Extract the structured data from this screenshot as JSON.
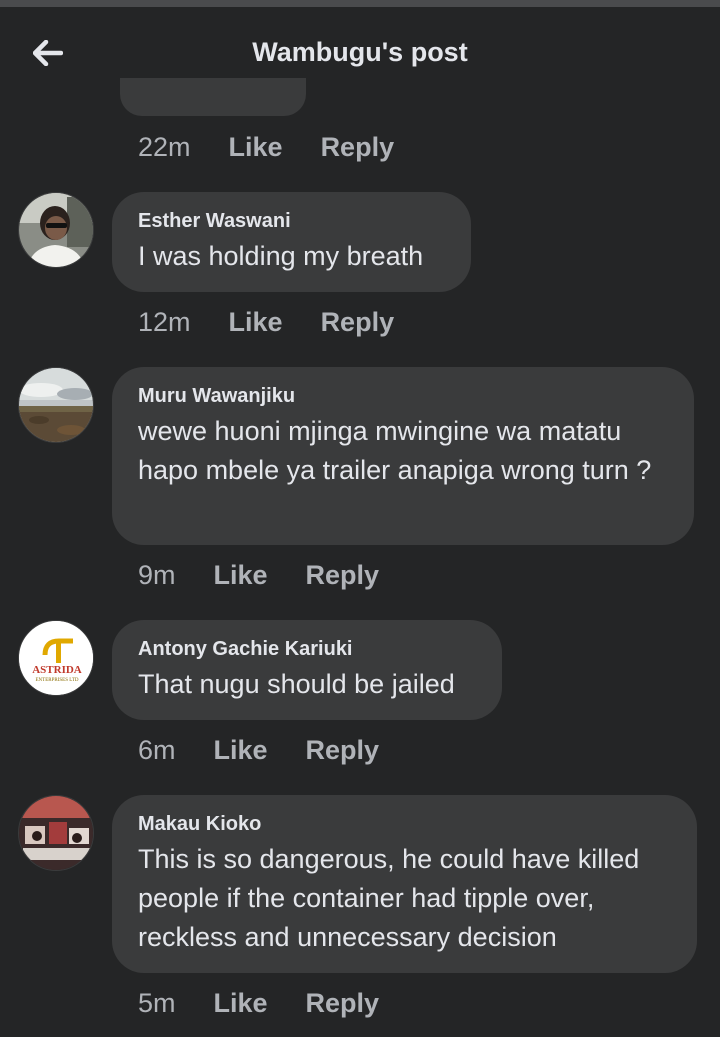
{
  "header": {
    "title": "Wambugu's post"
  },
  "comments": [
    {
      "author": "",
      "text": "",
      "time": "22m",
      "like": "Like",
      "reply": "Reply"
    },
    {
      "author": "Esther Waswani",
      "text": "I was holding my breath",
      "time": "12m",
      "like": "Like",
      "reply": "Reply"
    },
    {
      "author": "Muru Wawanjiku",
      "text": "wewe huoni mjinga mwingine wa matatu hapo mbele ya trailer anapiga wrong turn ?",
      "time": "9m",
      "like": "Like",
      "reply": "Reply"
    },
    {
      "author": "Antony Gachie Kariuki",
      "text": "That nugu should be jailed",
      "time": "6m",
      "like": "Like",
      "reply": "Reply"
    },
    {
      "author": "Makau Kioko",
      "text": "This is so dangerous, he could have killed people if the container had tipple over, reckless and unnecessary decision",
      "time": "5m",
      "like": "Like",
      "reply": "Reply"
    }
  ],
  "logo": {
    "brand": "ASTRIDA",
    "sub": "ENTERPRISES LTD"
  },
  "colors": {
    "background": "#242526",
    "bubble": "#3a3b3c",
    "secondary_text": "#b0b3b8",
    "primary_text": "#e4e6eb"
  }
}
